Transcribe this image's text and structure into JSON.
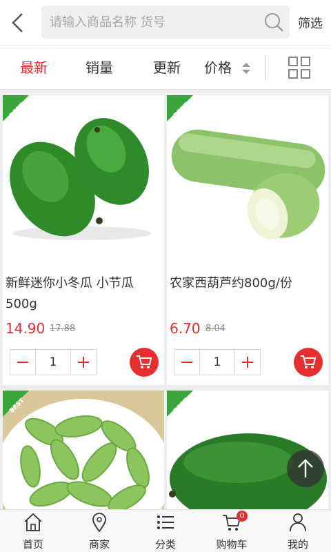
{
  "header": {
    "search_placeholder": "请输入商品名称 货号",
    "filter_label": "筛选"
  },
  "tabs": [
    {
      "label": "最新",
      "active": true
    },
    {
      "label": "销量",
      "active": false
    },
    {
      "label": "更新",
      "active": false
    },
    {
      "label": "价格",
      "active": false
    }
  ],
  "badge_text": "BEST",
  "products": [
    {
      "name": "新鲜迷你小冬瓜 小节瓜500g",
      "price": "14.90",
      "old_price": "17.88",
      "quantity": "1"
    },
    {
      "name": "农家西葫芦约800g/份",
      "price": "6.70",
      "old_price": "8.04",
      "quantity": "1"
    },
    {
      "name": "",
      "price": "",
      "old_price": "",
      "quantity": ""
    },
    {
      "name": "",
      "price": "",
      "old_price": "",
      "quantity": ""
    }
  ],
  "bottom_nav": [
    {
      "label": "首页",
      "icon": "home-icon"
    },
    {
      "label": "商家",
      "icon": "location-pin-icon"
    },
    {
      "label": "分类",
      "icon": "list-icon"
    },
    {
      "label": "购物车",
      "icon": "cart-icon",
      "badge": "0"
    },
    {
      "label": "我的",
      "icon": "user-icon"
    }
  ],
  "colors": {
    "accent": "#e02e2e",
    "best_badge": "#3aa53a",
    "background": "#eeeeee"
  }
}
